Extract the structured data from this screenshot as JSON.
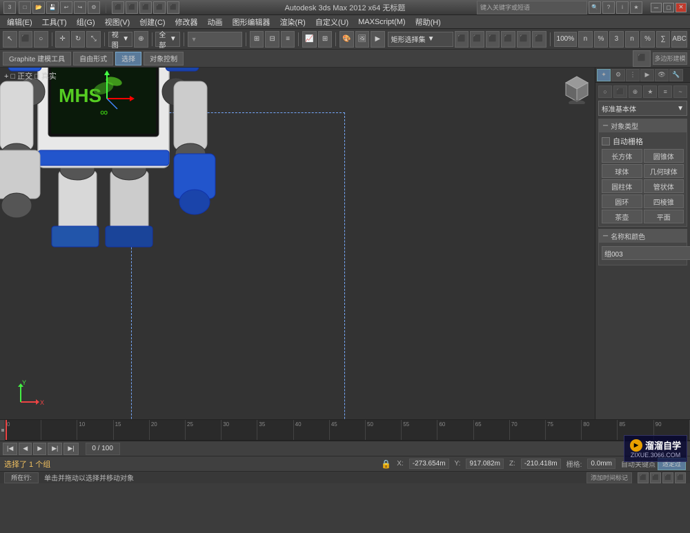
{
  "titlebar": {
    "title": "Autodesk 3ds Max 2012 x64 无标题",
    "search_placeholder": "键入关键字或短语",
    "icons": [
      "undo",
      "redo",
      "save",
      "open"
    ]
  },
  "menubar": {
    "items": [
      "编辑(E)",
      "工具(T)",
      "组(G)",
      "视图(V)",
      "创建(C)",
      "修改器",
      "动画",
      "图形编辑器",
      "渲染(R)",
      "自定义(U)",
      "MAXScript(M)",
      "帮助(H)"
    ]
  },
  "toolbar": {
    "mode_dropdown": "全部",
    "selection_dropdown": "矩形选择集",
    "percent": "100%"
  },
  "secondary_toolbar": {
    "graphite_label": "Graphite 建模工具",
    "freeform_label": "自由形式",
    "select_label": "选择",
    "obj_ctrl_label": "对象控制"
  },
  "viewport": {
    "view_label": "+ □ 正交 □ 真实"
  },
  "right_panel": {
    "dropdown": "标准基本体",
    "section_object_type": "对象类型",
    "auto_grid": "自动栅格",
    "object_types": [
      "长方体",
      "圆锥体",
      "球体",
      "几何球体",
      "圆柱体",
      "管状体",
      "圆环",
      "四棱锥",
      "茶壶",
      "平面"
    ],
    "section_name_color": "名称和颜色",
    "name_value": "组003"
  },
  "statusbar": {
    "selected_text": "选择了 1 个组",
    "hint_text": "单击并拖动以选择并移动对象",
    "coord_x_label": "X:",
    "coord_x_value": "-273.654m",
    "coord_y_label": "Y:",
    "coord_y_value": "917.082m",
    "coord_z_label": "Z:",
    "coord_z_value": "-210.418m",
    "grid_label": "栅格:",
    "grid_value": "0.0mm",
    "autokey_label": "自动关键点",
    "filter_btn": "适定过滤",
    "add_time_tag": "添加时间标记",
    "selected_btn": "适定过"
  },
  "timeline": {
    "range": "0 / 100",
    "ticks": [
      "0",
      "10",
      "15",
      "20",
      "25",
      "30",
      "35",
      "40",
      "45",
      "50",
      "55",
      "60",
      "65",
      "70",
      "75",
      "80",
      "85",
      "90"
    ]
  },
  "watermark": {
    "logo": "▶",
    "title": "溜溜自学",
    "url": "ZIXUE.3066.COM"
  },
  "bottom_play": {
    "status_label": "所在行:"
  }
}
